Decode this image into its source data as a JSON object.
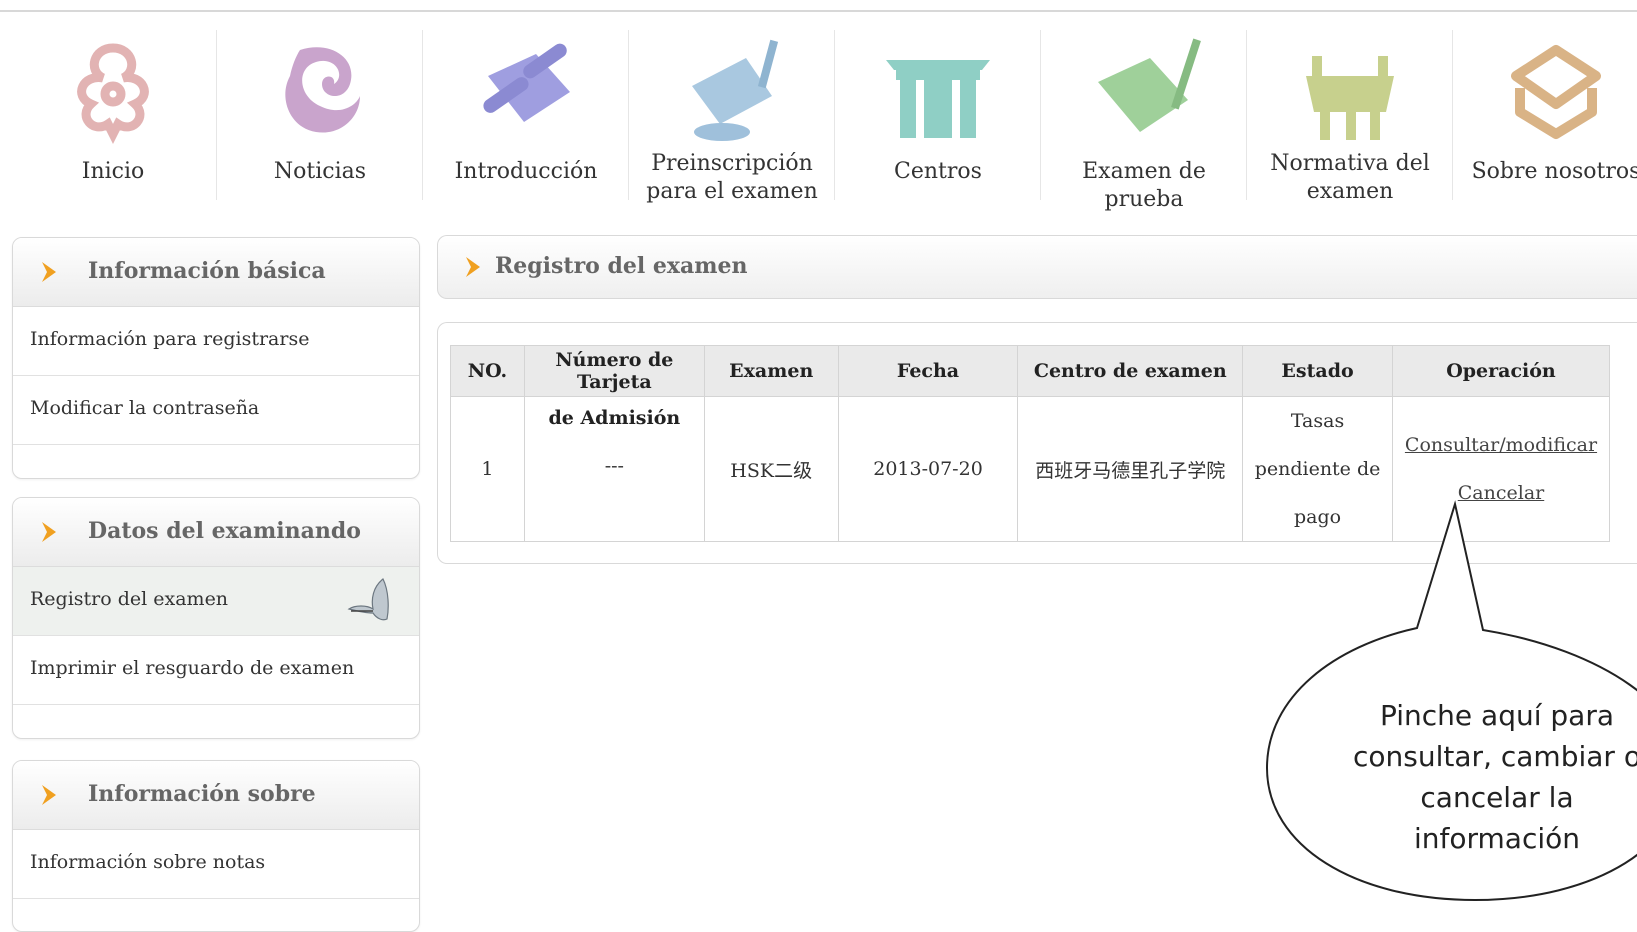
{
  "nav": {
    "items": [
      {
        "label": "Inicio",
        "icon": "ornament-knot-icon"
      },
      {
        "label": "Noticias",
        "icon": "cloud-swirl-icon"
      },
      {
        "label": "Introducción",
        "icon": "scroll-icon"
      },
      {
        "label": "Preinscripción para el examen",
        "icon": "scroll-brush-icon"
      },
      {
        "label": "Centros",
        "icon": "gate-icon"
      },
      {
        "label": "Examen de prueba",
        "icon": "paper-brush-icon"
      },
      {
        "label": "Normativa del examen",
        "icon": "bronze-vessel-icon"
      },
      {
        "label": "Sobre nosotros",
        "icon": "seal-box-icon"
      }
    ]
  },
  "sidebar": {
    "panel1": {
      "title": "Información básica",
      "items": [
        "Información para registrarse",
        "Modificar la contraseña"
      ]
    },
    "panel2": {
      "title": "Datos del examinando",
      "items": [
        "Registro del examen",
        "Imprimir el resguardo de examen"
      ]
    },
    "panel3": {
      "title": "Información sobre",
      "items": [
        "Información sobre notas"
      ]
    }
  },
  "main": {
    "title": "Registro del examen",
    "table": {
      "headers": [
        "NO.",
        "Número de Tarjeta",
        "Examen",
        "Fecha",
        "Centro de examen",
        "Estado",
        "Operación"
      ],
      "header_continuation": "de Admisión",
      "row": {
        "no": "1",
        "tarjeta": "---",
        "examen": "HSK二级",
        "fecha": "2013-07-20",
        "centro": "西班牙马德里孔子学院",
        "estado_lines": [
          "Tasas",
          "pendiente de",
          "pago"
        ],
        "op_consultar": "Consultar/modificar",
        "op_cancelar": "Cancelar"
      }
    }
  },
  "callout": {
    "lines": [
      "Pinche aquí para",
      "consultar, cambiar o",
      "cancelar la",
      "información"
    ]
  },
  "colors": {
    "accent_chevron": "#f0a020",
    "active_row": "#eef1ee"
  }
}
